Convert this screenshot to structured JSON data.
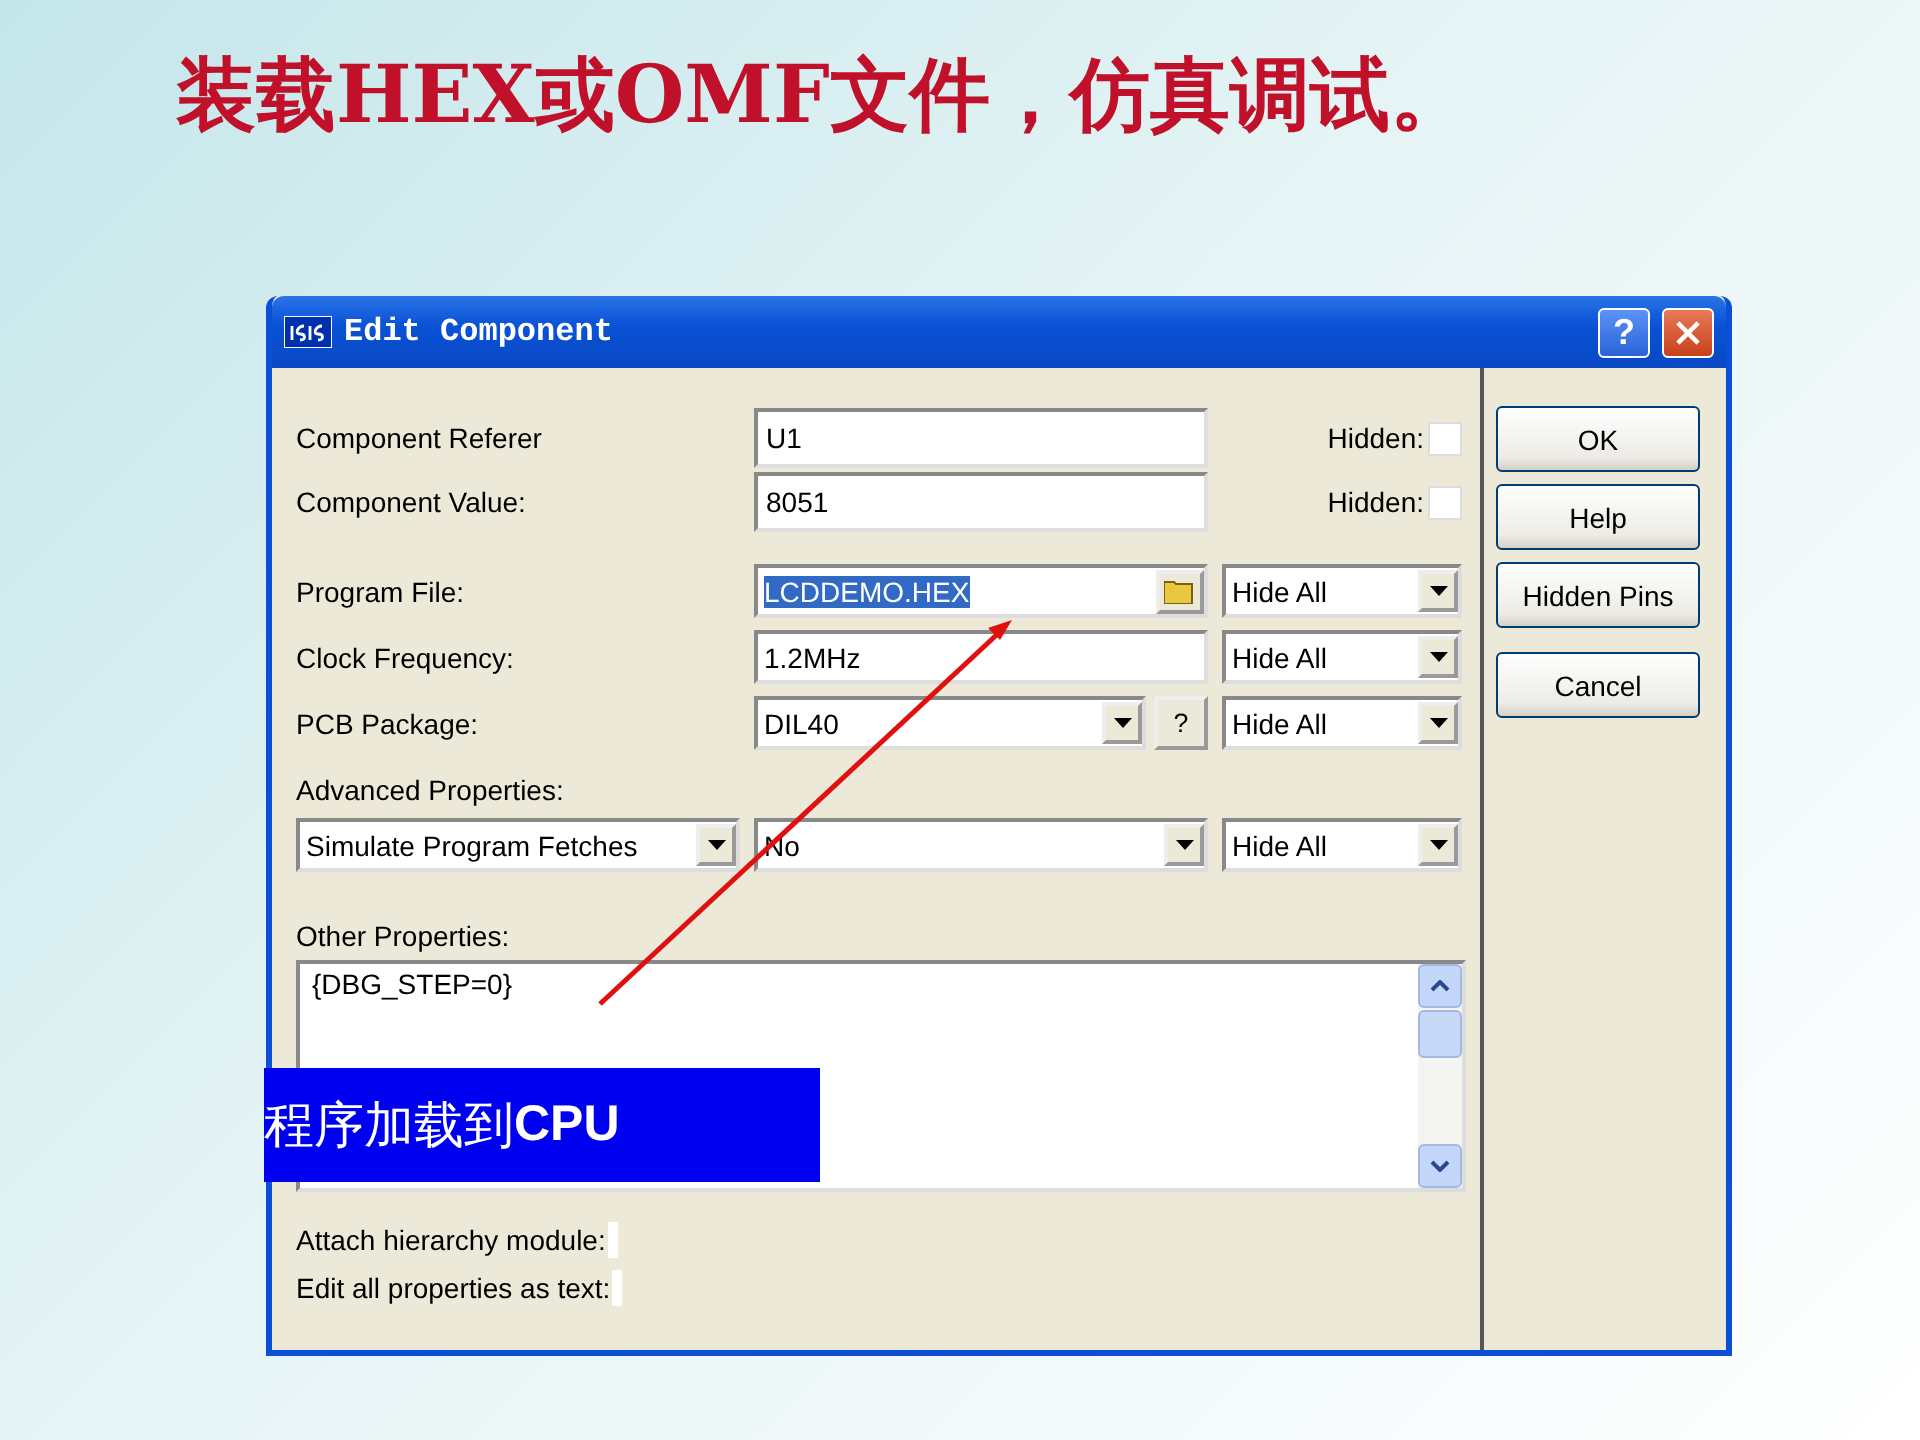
{
  "slide": {
    "title": "装载HEX或OMF文件，仿真调试。"
  },
  "dialog": {
    "title": "Edit Component",
    "help_button": "?",
    "rows": [
      {
        "kind": "text",
        "label": "Component Referer",
        "value": "U1",
        "hidden": {
          "label": "Hidden:",
          "checked": false
        }
      },
      {
        "kind": "text",
        "label": "Component Value:",
        "value": "8051",
        "hidden": {
          "label": "Hidden:",
          "checked": false
        }
      },
      {
        "kind": "file",
        "label": "Program File:",
        "value": "LCDDEMO.HEX",
        "text_selected": true,
        "visibility": "Hide All"
      },
      {
        "kind": "plain",
        "label": "Clock Frequency:",
        "value": "1.2MHz",
        "visibility": "Hide All"
      },
      {
        "kind": "package",
        "label": "PCB Package:",
        "value": "DIL40",
        "help": "?",
        "visibility": "Hide All"
      }
    ],
    "advanced": {
      "label": "Advanced Properties:",
      "property": "Simulate Program Fetches",
      "value": "No",
      "visibility": "Hide All"
    },
    "other": {
      "label": "Other Properties:",
      "text": "{DBG_STEP=0}"
    },
    "options": [
      {
        "label": "Attach hierarchy module:",
        "checked": false
      },
      {
        "label": "Edit all properties as text:",
        "checked": false
      }
    ],
    "buttons": [
      "OK",
      "Help",
      "Hidden Pins",
      "Cancel"
    ]
  },
  "callout": {
    "text": "程序加载到**CPU**"
  }
}
